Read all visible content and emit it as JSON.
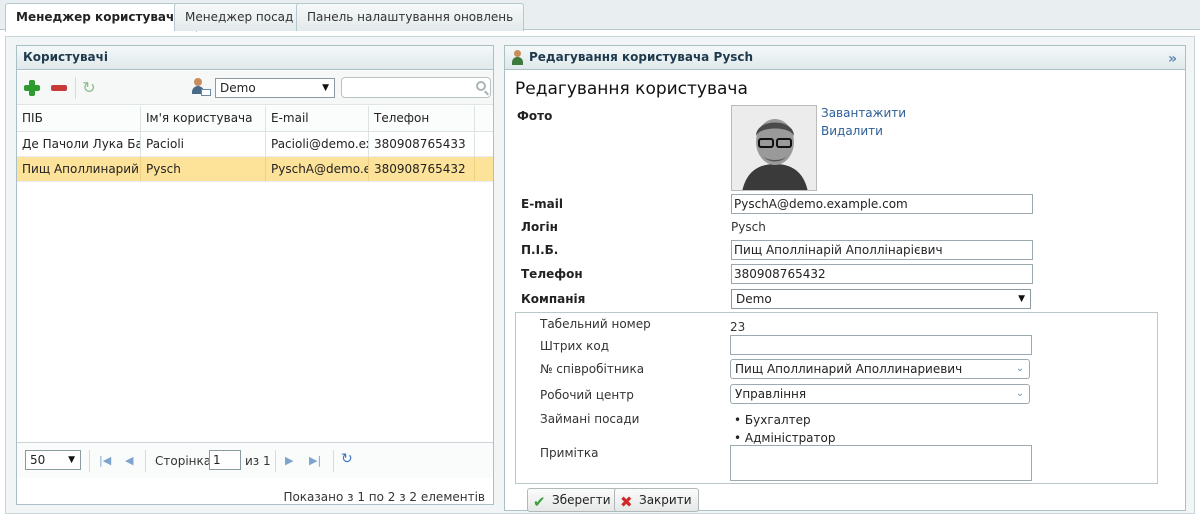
{
  "tabs": [
    {
      "label": "Менеджер користувачів"
    },
    {
      "label": "Менеджер посад"
    },
    {
      "label": "Панель налаштування оновлень"
    }
  ],
  "users_panel": {
    "title": "Користувачі",
    "company_filter": "Demo",
    "search_placeholder": "",
    "columns": [
      "ПІБ",
      "Ім'я користувача",
      "E-mail",
      "Телефон"
    ],
    "rows": [
      {
        "name": "Де Пачоли Лука Барт",
        "username": "Pacioli",
        "email": "Pacioli@demo.exa",
        "phone": "380908765433"
      },
      {
        "name": "Пищ Аполлинарий А",
        "username": "Pysch",
        "email": "PyschA@demo.ex",
        "phone": "380908765432"
      }
    ],
    "pager": {
      "page_size": "50",
      "page_label": "Сторінка",
      "current_page": "1",
      "of_label": "из 1",
      "shown_info": "Показано з  1 по 2  з  2 елементів"
    }
  },
  "edit_panel": {
    "header": "Редагування користувача Pysch",
    "title": "Редагування користувача",
    "photo_label": "Фото",
    "upload_link": "Завантажити",
    "delete_link": "Видалити",
    "email_label": "E-mail",
    "email_value": "PyschA@demo.example.com",
    "login_label": "Логін",
    "login_value": "Pysch",
    "fio_label": "П.І.Б.",
    "fio_value": "Пищ Аполлінарій Аполлінарієвич",
    "phone_label": "Телефон",
    "phone_value": "380908765432",
    "company_label": "Компанія",
    "company_value": "Demo",
    "tab_number_label": "Табельний номер",
    "tab_number_value": "23",
    "barcode_label": "Штрих код",
    "barcode_value": "",
    "employee_label": "№ співробітника",
    "employee_value": "Пищ Аполлинарий Аполлинариевич",
    "workcenter_label": "Робочий центр",
    "workcenter_value": "Управління",
    "positions_label": "Займані посади",
    "positions": [
      "Бухгалтер",
      "Адміністратор"
    ],
    "note_label": "Примітка",
    "note_value": "",
    "save_label": "Зберегти",
    "close_label": "Закрити"
  },
  "colors": {
    "selected_row": "#fde29a",
    "header_text": "#1f3a4d",
    "link": "#2e5f96"
  }
}
